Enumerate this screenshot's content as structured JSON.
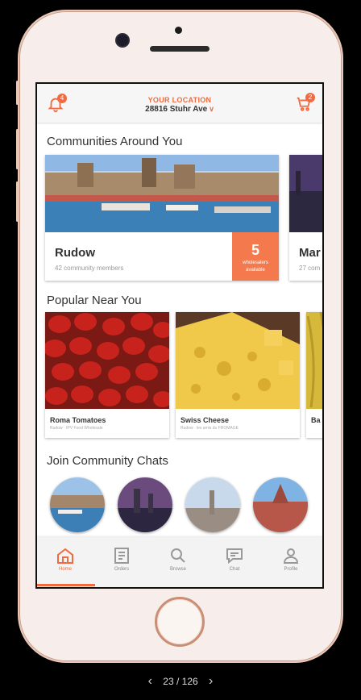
{
  "header": {
    "notification_count": "4",
    "location_label": "YOUR LOCATION",
    "location_address": "28816 Stuhr Ave",
    "cart_count": "2",
    "bell_icon": "bell-icon",
    "cart_icon": "cart-icon"
  },
  "sections": {
    "communities_title": "Communities Around You",
    "popular_title": "Popular Near You",
    "chats_title": "Join Community Chats"
  },
  "communities": [
    {
      "name": "Rudow",
      "members": "42 community members",
      "count": "5",
      "count_label_1": "wholesalers",
      "count_label_2": "available"
    },
    {
      "name": "Mar",
      "members": "27 com"
    }
  ],
  "products": [
    {
      "name": "Roma Tomatoes",
      "sub": "Rudow · IPV Food Wholesale"
    },
    {
      "name": "Swiss Cheese",
      "sub": "Rudow · les amis du FROMAGE"
    },
    {
      "name": "Ba",
      "sub": ""
    }
  ],
  "tabs": [
    {
      "label": "Home",
      "icon": "home-icon"
    },
    {
      "label": "Orders",
      "icon": "orders-icon"
    },
    {
      "label": "Browse",
      "icon": "search-icon"
    },
    {
      "label": "Chat",
      "icon": "chat-icon"
    },
    {
      "label": "Profile",
      "icon": "profile-icon"
    }
  ],
  "pager": {
    "current": "23",
    "separator": "/",
    "total": "126"
  },
  "colors": {
    "accent": "#f26a3f",
    "accent_box": "#f47a4e"
  }
}
